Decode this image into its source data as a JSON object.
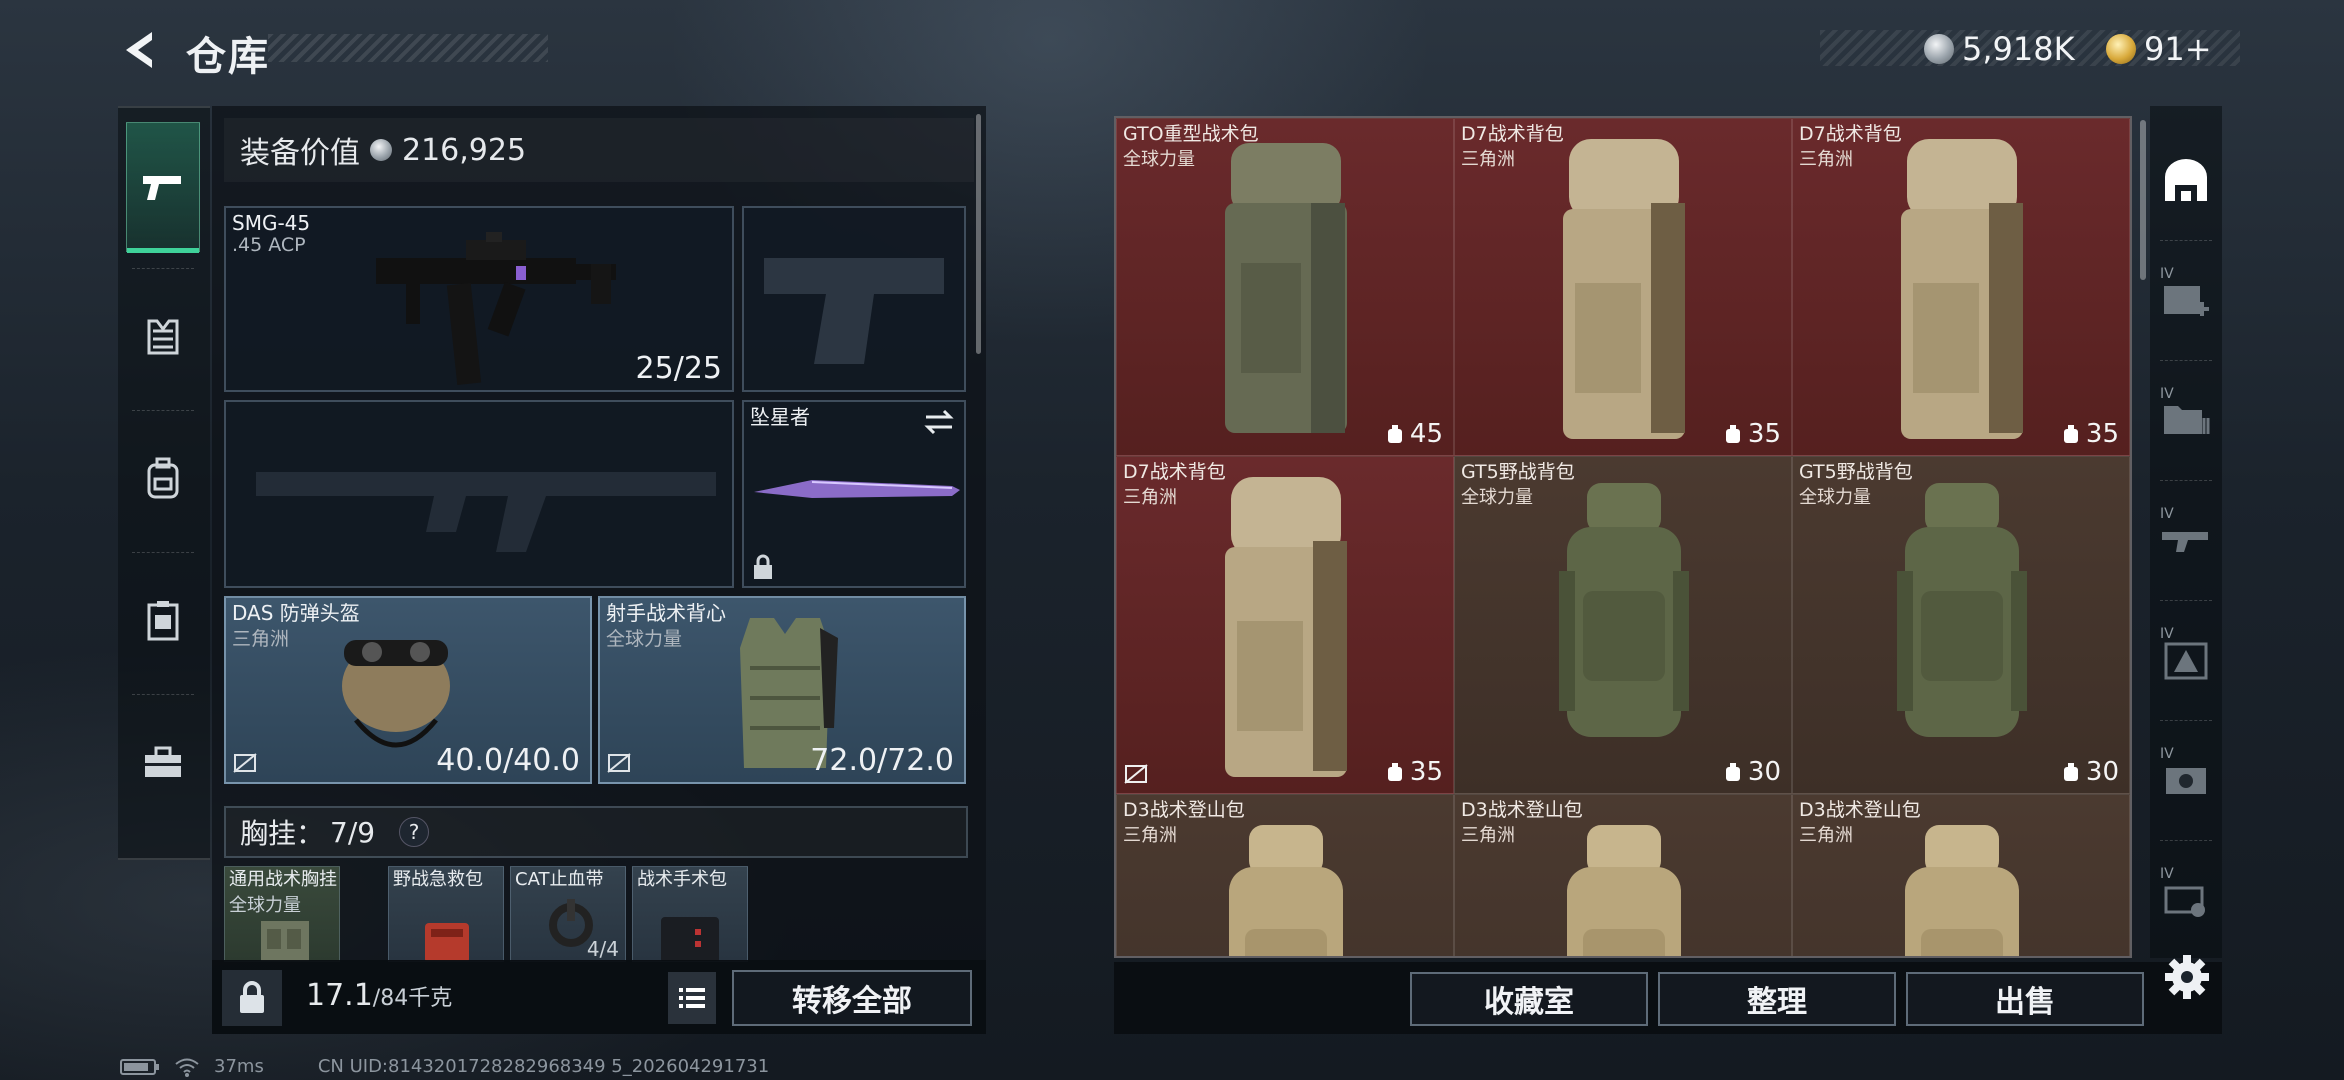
{
  "header": {
    "title": "仓库"
  },
  "currency": {
    "silver": "5,918K",
    "gold": "91+"
  },
  "equipment": {
    "value_label": "装备价值",
    "value": "216,925",
    "primary": {
      "name": "SMG-45",
      "ammo": ".45 ACP",
      "count": "25/25"
    },
    "melee": {
      "name": "坠星者"
    },
    "helmet": {
      "name": "DAS 防弹头盔",
      "origin": "三角洲",
      "durability": "40.0/40.0"
    },
    "armor": {
      "name": "射手战术背心",
      "origin": "全球力量",
      "durability": "72.0/72.0"
    },
    "chest": {
      "label": "胸挂：",
      "slots": "7/9",
      "help": "?"
    },
    "chest_items": [
      {
        "name": "通用战术胸挂",
        "sub": "全球力量"
      },
      {
        "name": "野战急救包",
        "sub": ""
      },
      {
        "name": "CAT止血带",
        "sub": "4/4"
      },
      {
        "name": "战术手术包",
        "sub": ""
      }
    ]
  },
  "left_footer": {
    "weight": "17.1",
    "weight_max": "/84千克",
    "transfer_all": "转移全部"
  },
  "inventory": [
    {
      "name": "GTO重型战术包",
      "sub": "全球力量",
      "cap": "45",
      "tone": "red",
      "style": "tall-green"
    },
    {
      "name": "D7战术背包",
      "sub": "三角洲",
      "cap": "35",
      "tone": "red",
      "style": "tall-tan"
    },
    {
      "name": "D7战术背包",
      "sub": "三角洲",
      "cap": "35",
      "tone": "red",
      "style": "tall-tan"
    },
    {
      "name": "D7战术背包",
      "sub": "三角洲",
      "cap": "35",
      "tone": "red",
      "style": "tall-tan"
    },
    {
      "name": "GT5野战背包",
      "sub": "全球力量",
      "cap": "30",
      "tone": "brown",
      "style": "ruck-green"
    },
    {
      "name": "GT5野战背包",
      "sub": "全球力量",
      "cap": "30",
      "tone": "brown",
      "style": "ruck-green"
    },
    {
      "name": "D3战术登山包",
      "sub": "三角洲",
      "cap": "",
      "tone": "brown",
      "style": "ruck-tan"
    },
    {
      "name": "D3战术登山包",
      "sub": "三角洲",
      "cap": "",
      "tone": "brown",
      "style": "ruck-tan"
    },
    {
      "name": "D3战术登山包",
      "sub": "三角洲",
      "cap": "",
      "tone": "brown",
      "style": "ruck-tan"
    }
  ],
  "right_footer": {
    "collection": "收藏室",
    "sort": "整理",
    "sell": "出售"
  },
  "status": {
    "ping": "37ms",
    "uid": "CN UID:8143201728282968349 5_202604291731"
  }
}
